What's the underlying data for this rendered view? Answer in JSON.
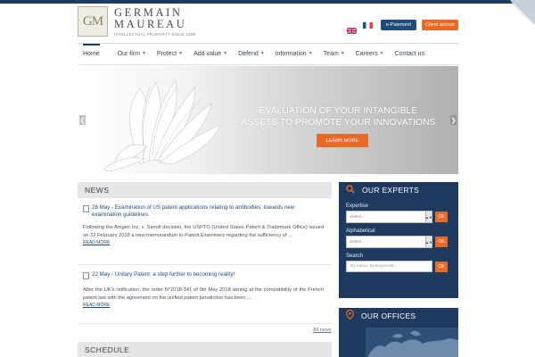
{
  "logo": {
    "initials": "GM",
    "name_line1": "GERMAIN",
    "name_line2": "MAUREAU",
    "tagline": "INTELLECTUAL PROPERTY SINCE 1898"
  },
  "header": {
    "epayment_label": "e-Paiement",
    "client_access_label": "Client access"
  },
  "nav": {
    "items": [
      "Home",
      "Our firm",
      "Protect",
      "Add value",
      "Defend",
      "Information",
      "Team",
      "Careers",
      "Contact us"
    ]
  },
  "banner": {
    "title_line1": "EVALUATION OF YOUR INTANGIBLE",
    "title_line2": "ASSETS TO PROMOTE YOUR INNOVATIONS",
    "button_label": "LEARN MORE"
  },
  "news": {
    "heading": "NEWS",
    "items": [
      {
        "title": "28 May - Examination of US patent applications relating to antibodies: towards new examination guidelines",
        "body": "Following the Amgen Inc. v. Sanofi decision, the USPTO (United States Patent & Trademark Office) issued on 22 February 2018 a new memorandum to Patent Examiners regarding the sufficiency of ...",
        "read_more": "READ MORE"
      },
      {
        "title": "22 May - Unitary Patent: a step further to becoming reality!",
        "body": "After the UK's ratification, the order N°2018-341 of 9th May 2018 aiming at the compatibility of the French patent law with the agreement on the unified patent jurisdiction has been ...",
        "read_more": "READ MORE"
      }
    ],
    "all_news": "All news"
  },
  "schedule": {
    "heading": "SCHEDULE"
  },
  "experts": {
    "heading": "OUR EXPERTS",
    "expertise_label": "Expertise",
    "expertise_placeholder": "Select...",
    "alpha_label": "Alphabetical",
    "alpha_placeholder": "Select...",
    "search_label": "Search",
    "search_placeholder": "By name, by keywords...",
    "ok_label": "OK"
  },
  "offices": {
    "heading": "OUR OFFICES"
  },
  "colors": {
    "navy": "#1e3a5f",
    "orange": "#e86a24",
    "link": "#1f4b7a"
  }
}
